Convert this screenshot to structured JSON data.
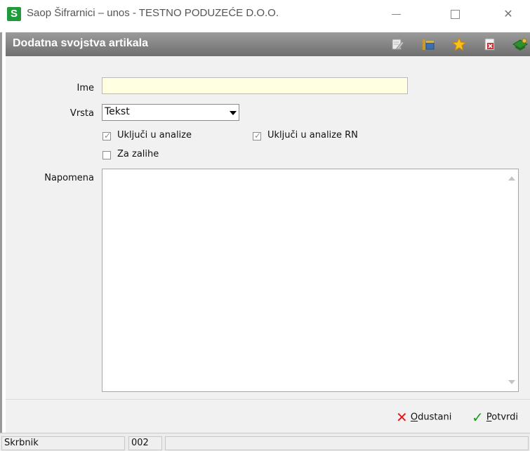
{
  "window": {
    "logo_letter": "S",
    "title": "Saop Šifrarnici – unos - TESTNO PODUZEĆE D.O.O."
  },
  "panel": {
    "title": "Dodatna svojstva artikala",
    "toolbar_icons": [
      "edit-icon",
      "layout-icon",
      "star-icon",
      "delete-icon",
      "help-book-icon"
    ]
  },
  "form": {
    "ime_label": "Ime",
    "ime_value": "",
    "vrsta_label": "Vrsta",
    "vrsta_value": "Tekst",
    "cb_analize_label": "Uključi u analize",
    "cb_analize_checked": true,
    "cb_analize_rn_label": "Uključi u analize RN",
    "cb_analize_rn_checked": true,
    "cb_zalihe_label": "Za zalihe",
    "cb_zalihe_checked": false,
    "napomena_label": "Napomena",
    "napomena_value": ""
  },
  "actions": {
    "cancel_hotkey": "O",
    "cancel_rest": "dustani",
    "confirm_hotkey": "P",
    "confirm_rest": "otvrdi"
  },
  "status": {
    "user": "Skrbnik",
    "code": "002",
    "extra": ""
  },
  "colors": {
    "logo": "#1e9c3c",
    "required_field_bg": "#ffffe1",
    "cancel_icon": "#e01b1b",
    "confirm_icon": "#1c9a1c"
  }
}
